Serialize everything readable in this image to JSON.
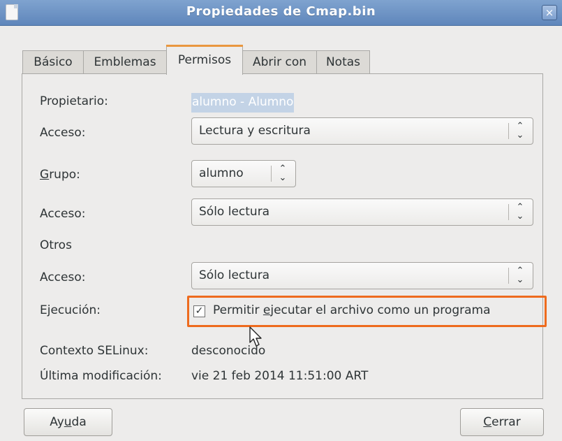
{
  "window": {
    "title": "Propiedades de Cmap.bin",
    "close_glyph": "×"
  },
  "tabs": [
    {
      "label": "Básico"
    },
    {
      "label": "Emblemas"
    },
    {
      "label": "Permisos"
    },
    {
      "label": "Abrir con"
    },
    {
      "label": "Notas"
    }
  ],
  "active_tab": "Permisos",
  "permissions": {
    "owner_label": "Propietario:",
    "owner_value": "alumno - Alumno",
    "owner_access_label": "Acceso:",
    "owner_access_value": "Lectura y escritura",
    "group_label": "Grupo:",
    "group_value": "alumno",
    "group_access_label": "Acceso:",
    "group_access_value": "Sólo lectura",
    "others_label": "Otros",
    "others_access_label": "Acceso:",
    "others_access_value": "Sólo lectura",
    "execution_label": "Ejecución:",
    "execution_checkbox_label": "Permitir ejecutar el archivo como un programa",
    "execution_checked": true,
    "selinux_label": "Contexto SELinux:",
    "selinux_value": "desconocido",
    "modified_label": "Última modificación:",
    "modified_value": "vie 21 feb 2014 11:51:00 ART"
  },
  "buttons": {
    "help": "Ayuda",
    "close": "Cerrar"
  },
  "colors": {
    "titlebar": "#6f95c6",
    "highlight_box": "#ee6b1e",
    "selection": "#c3d3e6",
    "active_tab_accent": "#e9973f"
  },
  "icons": {
    "combo_arrow": "up-down-chevron-icon",
    "check": "checkmark-icon",
    "window_icon": "file-icon",
    "close": "close-icon"
  }
}
